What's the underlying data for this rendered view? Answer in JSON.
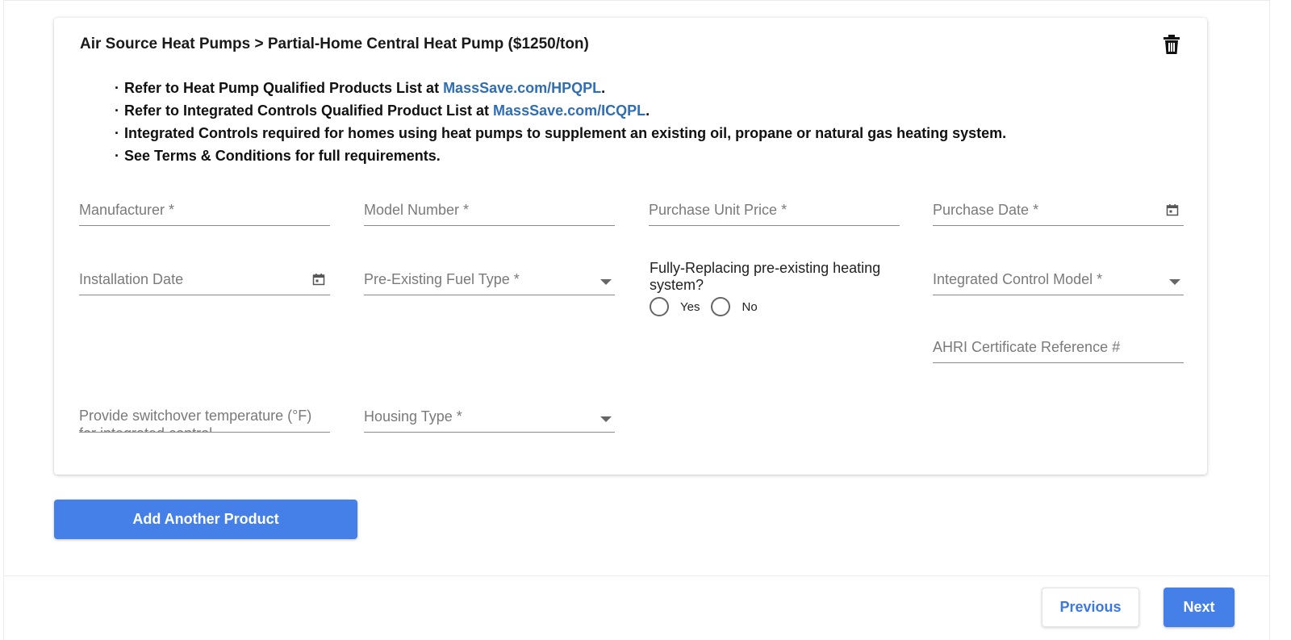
{
  "card": {
    "title": "Air Source Heat Pumps > Partial-Home Central Heat Pump ($1250/ton)",
    "bullets": [
      {
        "text": "Refer to Heat Pump Qualified Products List at ",
        "link": "MassSave.com/HPQPL",
        "tail": "."
      },
      {
        "text": "Refer to Integrated Controls Qualified Product List at ",
        "link": "MassSave.com/ICQPL",
        "tail": "."
      },
      {
        "text": "Integrated Controls required for homes using heat pumps to supplement an existing oil, propane or natural gas heating system.",
        "link": "",
        "tail": ""
      },
      {
        "text": "See Terms & Conditions for full requirements.",
        "link": "",
        "tail": ""
      }
    ]
  },
  "fields": {
    "manufacturer": {
      "label": "Manufacturer *",
      "value": ""
    },
    "model_number": {
      "label": "Model Number *",
      "value": ""
    },
    "purchase_unit_price": {
      "label": "Purchase Unit Price *",
      "value": ""
    },
    "purchase_date": {
      "label": "Purchase Date *",
      "value": ""
    },
    "installation_date": {
      "label": "Installation Date",
      "value": ""
    },
    "pre_existing_fuel_type": {
      "label": "Pre-Existing Fuel Type *",
      "value": ""
    },
    "integrated_control_model": {
      "label": "Integrated Control Model *",
      "value": ""
    },
    "ahri_certificate": {
      "label": "AHRI Certificate Reference #",
      "value": ""
    },
    "switchover_temperature": {
      "label": "Provide switchover temperature (°F) for integrated control",
      "value": ""
    },
    "housing_type": {
      "label": "Housing Type *",
      "value": ""
    }
  },
  "fully_replacing": {
    "question": "Fully-Replacing pre-existing heating system?",
    "options": [
      "Yes",
      "No"
    ]
  },
  "buttons": {
    "add_another": "Add Another Product",
    "previous": "Previous",
    "next": "Next"
  },
  "colors": {
    "primary": "#4480e8",
    "link": "#2f6db5"
  }
}
